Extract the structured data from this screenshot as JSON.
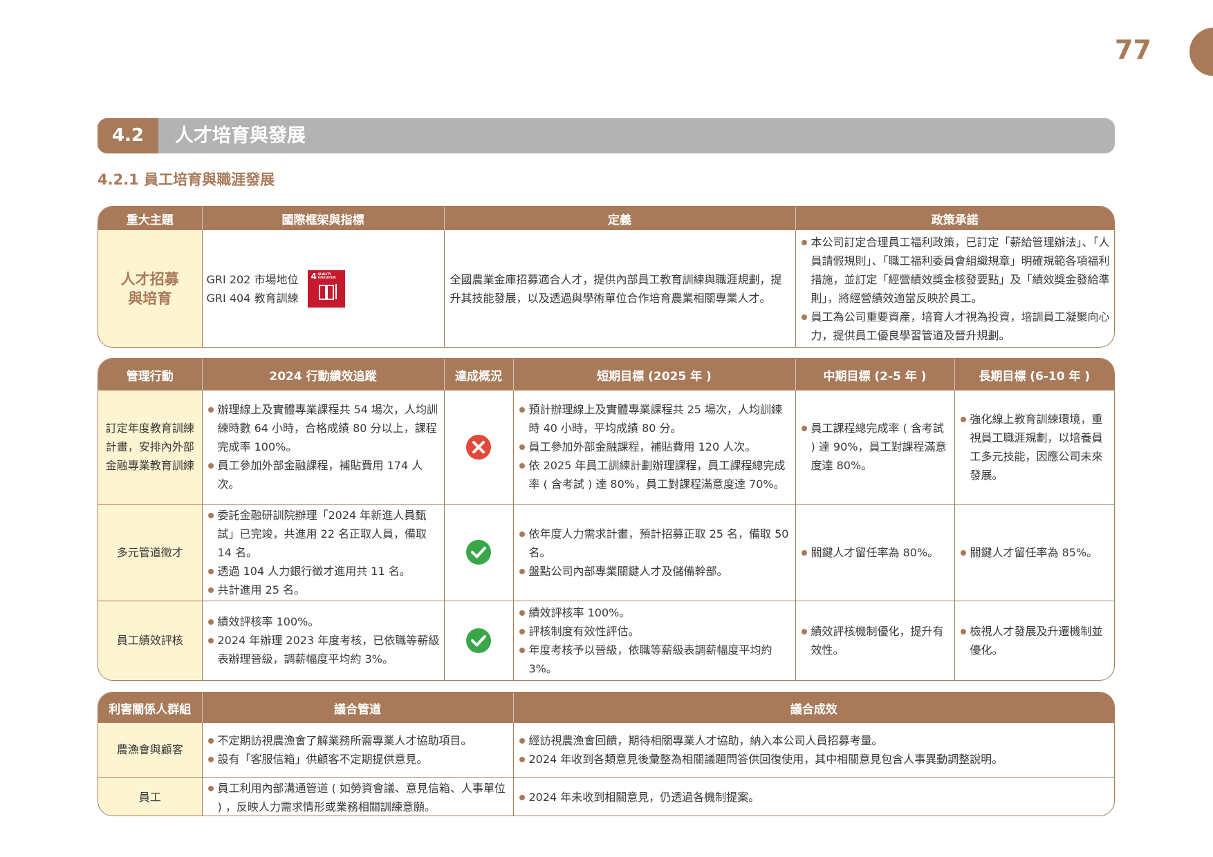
{
  "page_number": "77",
  "section": {
    "number": "4.2",
    "title": "人才培育與發展"
  },
  "subsection": {
    "title": "4.2.1 員工培育與職涯發展"
  },
  "topic_table": {
    "headers": [
      "重大主題",
      "國際框架與指標",
      "定義",
      "政策承諾"
    ],
    "topic": "人才招募與培育",
    "frameworks": [
      "GRI 202 市場地位",
      "GRI 404 教育訓練"
    ],
    "sdg": {
      "number": "4",
      "label": "QUALITY EDUCATION",
      "icon": "sdg4-quality-education-icon",
      "color": "#c5192d"
    },
    "definition": "全國農業金庫招募適合人才，提供內部員工教育訓練與職涯規劃，提升其技能發展，以及透過與學術單位合作培育農業相關專業人才。",
    "policy": [
      "本公司訂定合理員工福利政策，已訂定「薪給管理辦法」、「人員請假規則」、「職工福利委員會組織規章」明確規範各項福利措施，並訂定「經營績效獎金核發要點」及「績效獎金發給準則」，將經營績效適當反映於員工。",
      "員工為公司重要資產，培育人才視為投資，培訓員工凝聚向心力，提供員工優良學習管道及晉升規劃。"
    ]
  },
  "action_table": {
    "headers": [
      "管理行動",
      "2024 行動績效追蹤",
      "達成概況",
      "短期目標 (2025 年 )",
      "中期目標 (2-5 年 )",
      "長期目標 (6-10 年 )"
    ],
    "rows": [
      {
        "action": "訂定年度教育訓練計畫，安排內外部金融專業教育訓練",
        "tracking": [
          "辦理線上及實體專業課程共 54 場次，人均訓練時數 64 小時，合格成績 80 分以上，課程完成率 100%。",
          "員工參加外部金融課程，補貼費用 174 人次。"
        ],
        "status": "not-achieved",
        "short": [
          "預計辦理線上及實體專業課程共 25 場次，人均訓練時 40 小時，平均成績 80 分。",
          "員工參加外部金融課程，補貼費用 120 人次。",
          "依 2025 年員工訓練計劃辦理課程，員工課程總完成率 ( 含考試 ) 達 80%，員工對課程滿意度達 70%。"
        ],
        "mid": [
          "員工課程總完成率 ( 含考試 ) 達 90%，員工對課程滿意度達 80%。"
        ],
        "long": [
          "強化線上教育訓練環境，重視員工職涯規劃，以培養員工多元技能，因應公司未來發展。"
        ]
      },
      {
        "action": "多元管道徵才",
        "tracking": [
          "委託金融研訓院辦理「2024 年新進人員甄試」已完竣，共進用 22 名正取人員，備取 14 名。",
          "透過 104 人力銀行徵才進用共 11 名。",
          "共計進用 25 名。"
        ],
        "status": "achieved",
        "short": [
          "依年度人力需求計畫，預計招募正取 25 名，備取 50 名。",
          "盤點公司內部專業關鍵人才及儲備幹部。"
        ],
        "mid": [
          "關鍵人才留任率為 80%。"
        ],
        "long": [
          "關鍵人才留任率為 85%。"
        ]
      },
      {
        "action": "員工績效評核",
        "tracking": [
          "績效評核率 100%。",
          "2024 年辦理 2023 年度考核，已依職等薪級表辦理晉級，調薪幅度平均約 3%。"
        ],
        "status": "achieved",
        "short": [
          "績效評核率 100%。",
          "評核制度有效性評估。",
          "年度考核予以晉級，依職等薪級表調薪幅度平均約 3%。"
        ],
        "mid": [
          "績效評核機制優化，提升有效性。"
        ],
        "long": [
          "檢視人才發展及升遷機制並優化。"
        ]
      }
    ]
  },
  "stakeholder_table": {
    "headers": [
      "利害關係人群組",
      "議合管道",
      "議合成效"
    ],
    "rows": [
      {
        "group": "農漁會與顧客",
        "channels": [
          "不定期訪視農漁會了解業務所需專業人才協助項目。",
          "設有「客服信箱」供顧客不定期提供意見。"
        ],
        "results": [
          "經訪視農漁會回饋，期待相關專業人才協助，納入本公司人員招募考量。",
          "2024 年收到各類意見後彙整為相關議題問答供回復使用，其中相關意見包含人事異動調整說明。"
        ]
      },
      {
        "group": "員工",
        "channels": [
          "員工利用內部溝通管道 ( 如勞資會議、意見信箱、人事單位 ) ，反映人力需求情形或業務相關訓練意願。"
        ],
        "results": [
          "2024 年未收到相關意見，仍透過各機制提案。"
        ]
      }
    ]
  },
  "colors": {
    "brand": "#a87a5a",
    "topic_bg": "#fdf4d1",
    "section_bar": "#b3b3b3",
    "achieved": "#3aa64a",
    "not_achieved": "#e04a3a"
  }
}
